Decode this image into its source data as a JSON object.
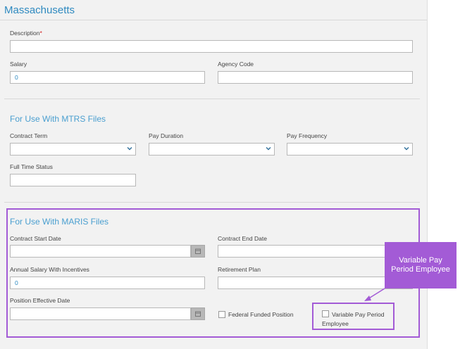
{
  "page": {
    "title": "Massachusetts"
  },
  "general": {
    "description_label": "Description",
    "description_required": "*",
    "description_value": "",
    "salary_label": "Salary",
    "salary_value": "0",
    "agency_code_label": "Agency Code",
    "agency_code_value": ""
  },
  "mtrs": {
    "heading": "For Use With MTRS Files",
    "contract_term_label": "Contract Term",
    "pay_duration_label": "Pay Duration",
    "pay_frequency_label": "Pay Frequency",
    "full_time_status_label": "Full Time Status",
    "full_time_status_value": ""
  },
  "maris": {
    "heading": "For Use With MARIS Files",
    "contract_start_label": "Contract Start Date",
    "contract_end_label": "Contract End Date",
    "annual_salary_label": "Annual Salary With Incentives",
    "annual_salary_value": "0",
    "retirement_plan_label": "Retirement Plan",
    "position_effective_label": "Position Effective Date",
    "federal_funded_label": "Federal Funded Position",
    "variable_pay_label_line1": "Variable Pay Period",
    "variable_pay_label_line2": "Employee"
  },
  "annotation": {
    "callout_line1": "Variable Pay",
    "callout_line2": "Period Employee",
    "highlight_color": "#a35bd6"
  },
  "colors": {
    "accent": "#2f8ac0",
    "required": "#d02020"
  }
}
